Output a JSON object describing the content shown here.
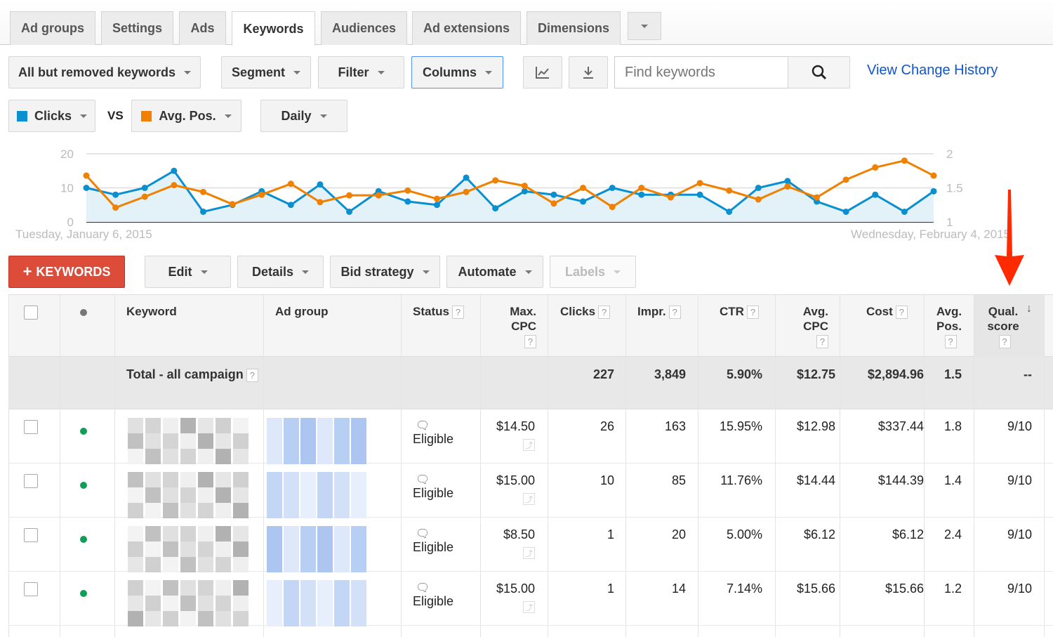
{
  "tabs": [
    {
      "label": "Ad groups"
    },
    {
      "label": "Settings"
    },
    {
      "label": "Ads"
    },
    {
      "label": "Keywords",
      "active": true
    },
    {
      "label": "Audiences"
    },
    {
      "label": "Ad extensions"
    },
    {
      "label": "Dimensions"
    }
  ],
  "toolbar": {
    "view_filter": "All but removed keywords",
    "segment": "Segment",
    "filter": "Filter",
    "columns": "Columns",
    "search_placeholder": "Find keywords",
    "change_history": "View Change History"
  },
  "chart_controls": {
    "metric1": "Clicks",
    "vs": "VS",
    "metric2": "Avg. Pos.",
    "period": "Daily"
  },
  "colors": {
    "clicks": "#0a8fd0",
    "avg_pos": "#f08000",
    "link": "#1155cc",
    "add_button": "#dd4b39",
    "status_dot": "#0f9d58",
    "arrow": "#ff2a00"
  },
  "chart_data": {
    "type": "line",
    "x_start_label": "Tuesday, January 6, 2015",
    "x_end_label": "Wednesday, February 4, 2015",
    "left_axis": {
      "ticks": [
        "0",
        "10",
        "20"
      ],
      "range": [
        0,
        20
      ]
    },
    "right_axis": {
      "ticks": [
        "1",
        "1.5",
        "2"
      ],
      "range": [
        1,
        2
      ]
    },
    "grid": true,
    "series": [
      {
        "name": "Clicks",
        "axis": "left",
        "area": true,
        "values": [
          10,
          8,
          10,
          15,
          3,
          5,
          9,
          5,
          11,
          3,
          9,
          6,
          5,
          13,
          4,
          9,
          8,
          6,
          10,
          8,
          8,
          8,
          3,
          10,
          12,
          6,
          3,
          8,
          3,
          9
        ]
      },
      {
        "name": "Avg. Pos.",
        "axis": "right",
        "values": [
          1.68,
          1.21,
          1.37,
          1.54,
          1.44,
          1.26,
          1.4,
          1.56,
          1.29,
          1.39,
          1.39,
          1.46,
          1.34,
          1.44,
          1.61,
          1.53,
          1.27,
          1.5,
          1.22,
          1.5,
          1.36,
          1.57,
          1.46,
          1.33,
          1.52,
          1.36,
          1.62,
          1.8,
          1.9,
          1.68
        ]
      }
    ]
  },
  "actions": {
    "add": "KEYWORDS",
    "edit": "Edit",
    "details": "Details",
    "bid_strategy": "Bid strategy",
    "automate": "Automate",
    "labels": "Labels"
  },
  "table": {
    "headers": {
      "keyword": "Keyword",
      "ad_group": "Ad group",
      "status": "Status",
      "max_cpc": "Max. CPC",
      "clicks": "Clicks",
      "impr": "Impr.",
      "ctr": "CTR",
      "avg_cpc": "Avg. CPC",
      "cost": "Cost",
      "avg_pos": "Avg. Pos.",
      "qual": "Qual. score",
      "help": "?"
    },
    "total": {
      "label": "Total - all campaign",
      "clicks": "227",
      "impr": "3,849",
      "ctr": "5.90%",
      "avg_cpc": "$12.75",
      "cost": "$2,894.96",
      "avg_pos": "1.5",
      "qual": "--"
    },
    "rows": [
      {
        "status": "Eligible",
        "max_cpc": "$14.50",
        "clicks": "26",
        "impr": "163",
        "ctr": "15.95%",
        "avg_cpc": "$12.98",
        "cost": "$337.44",
        "avg_pos": "1.8",
        "qual": "9/10"
      },
      {
        "status": "Eligible",
        "max_cpc": "$15.00",
        "clicks": "10",
        "impr": "85",
        "ctr": "11.76%",
        "avg_cpc": "$14.44",
        "cost": "$144.39",
        "avg_pos": "1.4",
        "qual": "9/10"
      },
      {
        "status": "Eligible",
        "max_cpc": "$8.50",
        "clicks": "1",
        "impr": "20",
        "ctr": "5.00%",
        "avg_cpc": "$6.12",
        "cost": "$6.12",
        "avg_pos": "2.4",
        "qual": "9/10"
      },
      {
        "status": "Eligible",
        "max_cpc": "$15.00",
        "clicks": "1",
        "impr": "14",
        "ctr": "7.14%",
        "avg_cpc": "$15.66",
        "cost": "$15.66",
        "avg_pos": "1.2",
        "qual": "9/10"
      }
    ]
  }
}
